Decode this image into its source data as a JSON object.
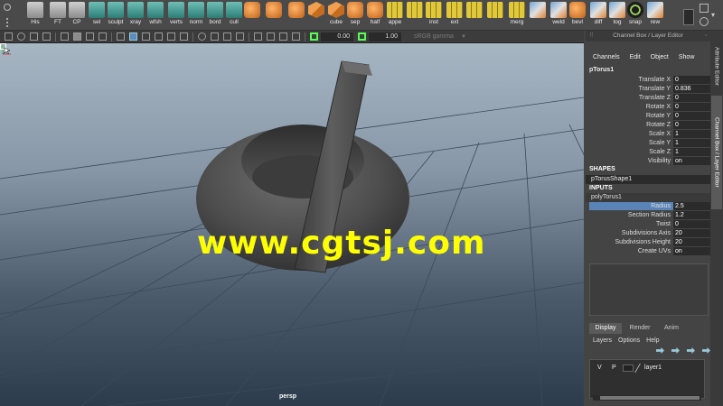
{
  "shelf": {
    "items": [
      {
        "label": "His",
        "icon": "script-icon",
        "style": "ico-gray"
      },
      {
        "label": "FT",
        "icon": "transform-icon",
        "style": "ico-gray"
      },
      {
        "label": "CP",
        "icon": "pivot-icon",
        "style": "ico-gray"
      },
      {
        "label": "sel",
        "icon": "select-icon",
        "style": "ico-teal"
      },
      {
        "label": "sculpt",
        "icon": "sculpt-icon",
        "style": "ico-teal"
      },
      {
        "label": "xray",
        "icon": "xray-icon",
        "style": "ico-teal"
      },
      {
        "label": "wfsh",
        "icon": "wireframe-shaded-icon",
        "style": "ico-teal"
      },
      {
        "label": "verts",
        "icon": "vertex-icon",
        "style": "ico-teal"
      },
      {
        "label": "norm",
        "icon": "normals-icon",
        "style": "ico-teal"
      },
      {
        "label": "bord",
        "icon": "border-icon",
        "style": "ico-teal"
      },
      {
        "label": "cull",
        "icon": "cull-icon",
        "style": "ico-teal"
      },
      {
        "label": "",
        "icon": "poly-cube-icon",
        "style": "ico-orange"
      },
      {
        "label": "",
        "icon": "poly-plane-icon",
        "style": "ico-orange"
      },
      {
        "label": "",
        "icon": "poly-cylinder-icon",
        "style": "ico-orange"
      },
      {
        "label": "",
        "icon": "poly-box-icon",
        "style": "ico-cube"
      },
      {
        "label": "cube",
        "icon": "cube-icon",
        "style": "ico-cube"
      },
      {
        "label": "sep",
        "icon": "separate-icon",
        "style": "ico-orange"
      },
      {
        "label": "half",
        "icon": "half-icon",
        "style": "ico-orange"
      },
      {
        "label": "appe",
        "icon": "append-icon",
        "style": "ico-yellow"
      },
      {
        "label": "",
        "icon": "bridge-icon",
        "style": "ico-yellow"
      },
      {
        "label": "inst",
        "icon": "instance-icon",
        "style": "ico-yellow"
      },
      {
        "label": "ext",
        "icon": "extrude-icon",
        "style": "ico-yellow"
      },
      {
        "label": "",
        "icon": "bevel-icon",
        "style": "ico-yellow"
      },
      {
        "label": "",
        "icon": "split-icon",
        "style": "ico-yellow"
      },
      {
        "label": "merg",
        "icon": "merge-icon",
        "style": "ico-yellow"
      },
      {
        "label": "",
        "icon": "collapse-icon",
        "style": "ico-mix"
      },
      {
        "label": "weld",
        "icon": "weld-icon",
        "style": "ico-mix"
      },
      {
        "label": "bevl",
        "icon": "bevel-tool-icon",
        "style": "ico-orange"
      },
      {
        "label": "diff",
        "icon": "difference-icon",
        "style": "ico-mix"
      },
      {
        "label": "tog",
        "icon": "toggle-icon",
        "style": "ico-mix"
      },
      {
        "label": "snap",
        "icon": "snap-icon",
        "style": "ico-green"
      },
      {
        "label": "rew",
        "icon": "rewind-icon",
        "style": "ico-mix"
      }
    ]
  },
  "panel_toolbar": {
    "near_value": "0.00",
    "far_value": "1.00",
    "color_space": "sRGB gamma"
  },
  "viewport": {
    "camera": "persp",
    "watermark": "www.cgtsj.com"
  },
  "channel_box": {
    "title": "Channel Box / Layer Editor",
    "menu": [
      "Channels",
      "Edit",
      "Object",
      "Show"
    ],
    "node_name": "pTorus1",
    "attributes": [
      {
        "label": "Translate X",
        "value": "0"
      },
      {
        "label": "Translate Y",
        "value": "0.836"
      },
      {
        "label": "Translate Z",
        "value": "0"
      },
      {
        "label": "Rotate X",
        "value": "0"
      },
      {
        "label": "Rotate Y",
        "value": "0"
      },
      {
        "label": "Rotate Z",
        "value": "0"
      },
      {
        "label": "Scale X",
        "value": "1"
      },
      {
        "label": "Scale Y",
        "value": "1"
      },
      {
        "label": "Scale Z",
        "value": "1"
      },
      {
        "label": "Visibility",
        "value": "on"
      }
    ],
    "shapes_heading": "SHAPES",
    "shape_name": "pTorusShape1",
    "inputs_heading": "INPUTS",
    "input_name": "polyTorus1",
    "input_attributes": [
      {
        "label": "Radius",
        "value": "2.5"
      },
      {
        "label": "Section Radius",
        "value": "1.2"
      },
      {
        "label": "Twist",
        "value": "0"
      },
      {
        "label": "Subdivisions Axis",
        "value": "20"
      },
      {
        "label": "Subdivisions Height",
        "value": "20"
      },
      {
        "label": "Create UVs",
        "value": "on"
      }
    ]
  },
  "layer_editor": {
    "tabs": [
      "Display",
      "Render",
      "Anim"
    ],
    "menu": [
      "Layers",
      "Options",
      "Help"
    ],
    "layer": {
      "visible": "V",
      "playback": "P",
      "name": "layer1"
    }
  },
  "side_tabs": [
    "Attribute Editor",
    "Channel Box / Layer Editor"
  ]
}
